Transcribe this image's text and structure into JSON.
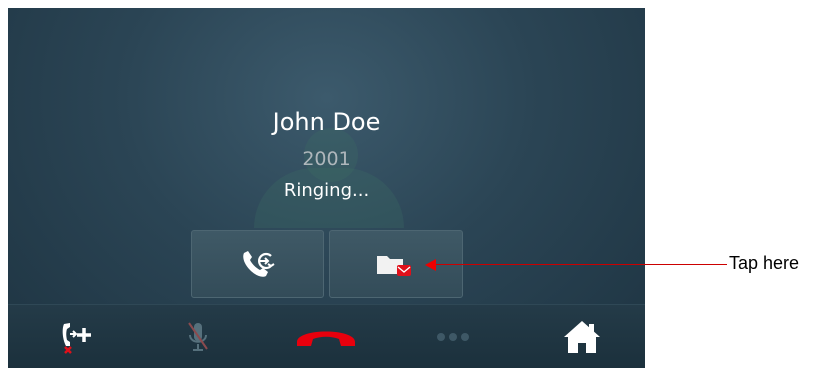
{
  "call": {
    "caller_name": "John Doe",
    "caller_number": "2001",
    "status": "Ringing..."
  },
  "actions": [
    {
      "icon": "call-transfer-icon"
    },
    {
      "icon": "voicemail-folder-icon"
    }
  ],
  "bottom_bar": [
    {
      "icon": "conference-add-icon"
    },
    {
      "icon": "mute-microphone-icon"
    },
    {
      "icon": "end-call-icon"
    },
    {
      "icon": "more-options-icon"
    },
    {
      "icon": "home-icon"
    }
  ],
  "annotation": {
    "label": "Tap here"
  },
  "colors": {
    "end_call": "#e8000d",
    "voicemail_badge": "#e0101a",
    "annotation": "#cc0000"
  }
}
